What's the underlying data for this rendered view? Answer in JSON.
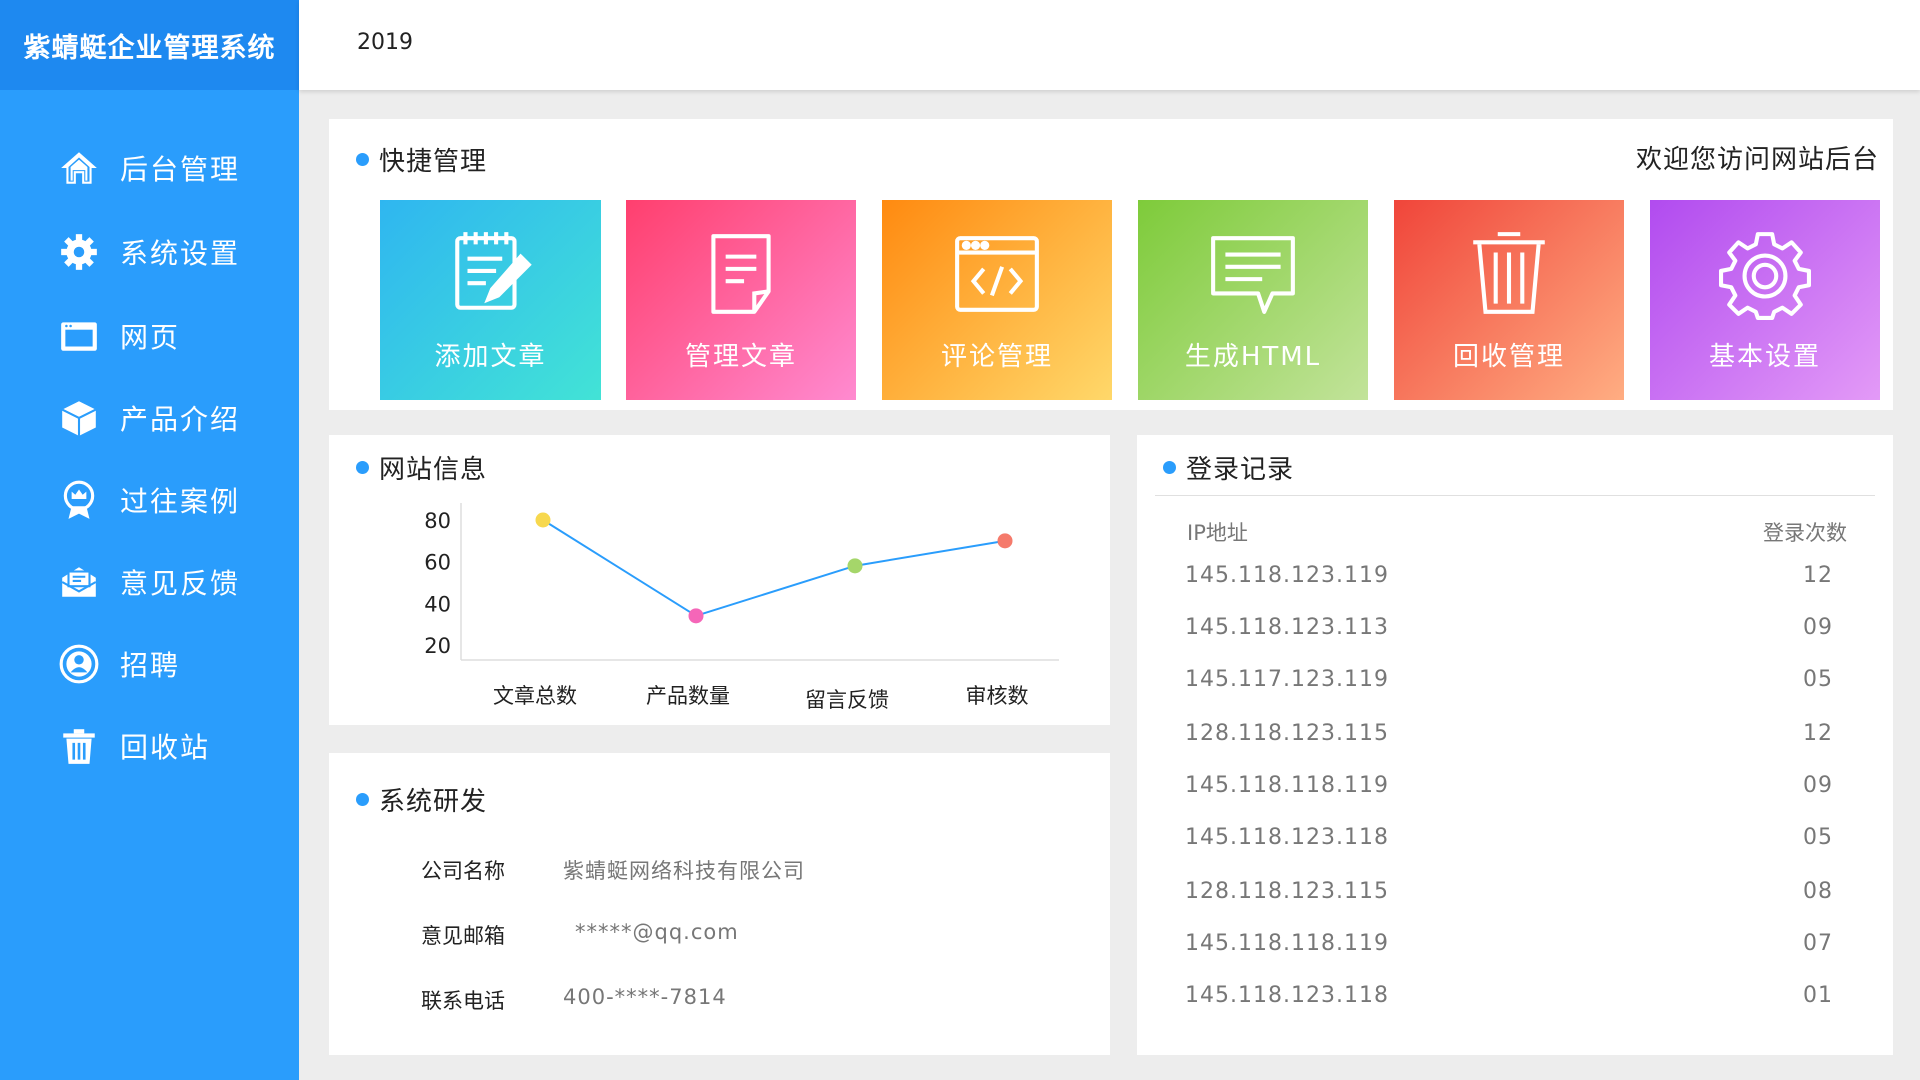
{
  "app": {
    "title": "紫蜻蜓企业管理系统",
    "year": "2019"
  },
  "sidebar": {
    "items": [
      {
        "label": "后台管理",
        "icon": "home-icon"
      },
      {
        "label": "系统设置",
        "icon": "gear-icon"
      },
      {
        "label": "网页",
        "icon": "browser-window-icon"
      },
      {
        "label": "产品介绍",
        "icon": "cube-icon"
      },
      {
        "label": "过往案例",
        "icon": "badge-icon"
      },
      {
        "label": "意见反馈",
        "icon": "feedback-icon"
      },
      {
        "label": "招聘",
        "icon": "user-circle-icon"
      },
      {
        "label": "回收站",
        "icon": "trash-icon"
      }
    ]
  },
  "quick": {
    "title": "快捷管理",
    "welcome": "欢迎您访问网站后台",
    "tiles": [
      {
        "label": "添加文章",
        "icon": "edit-document-icon",
        "colors": [
          "#2fb6f0",
          "#42e3d6"
        ]
      },
      {
        "label": "管理文章",
        "icon": "document-icon",
        "colors": [
          "#ff3f6e",
          "#ff8ad0"
        ]
      },
      {
        "label": "评论管理",
        "icon": "code-window-icon",
        "colors": [
          "#ff8a10",
          "#ffd86a"
        ]
      },
      {
        "label": "生成HTML",
        "icon": "message-icon",
        "colors": [
          "#7ecb3a",
          "#c2e39a"
        ]
      },
      {
        "label": "回收管理",
        "icon": "trash-icon",
        "colors": [
          "#f0453a",
          "#ffad82"
        ]
      },
      {
        "label": "基本设置",
        "icon": "gear-icon",
        "colors": [
          "#b14bef",
          "#e39af7"
        ]
      }
    ]
  },
  "site_info": {
    "title": "网站信息"
  },
  "chart_data": {
    "type": "line",
    "categories": [
      "文章总数",
      "产品数量",
      "留言反馈",
      "审核数"
    ],
    "values": [
      80,
      34,
      58,
      70
    ],
    "point_colors": [
      "#f7d84e",
      "#f566b8",
      "#a5d66a",
      "#f57a6b"
    ],
    "line_color": "#2a9dfc",
    "yticks": [
      80,
      60,
      40,
      20
    ],
    "ylim": [
      20,
      80
    ],
    "title": "",
    "xlabel": "",
    "ylabel": ""
  },
  "dev": {
    "title": "系统研发",
    "rows": [
      {
        "key": "公司名称",
        "value": "紫蜻蜓网络科技有限公司"
      },
      {
        "key": "意见邮箱",
        "value": "*****@qq.com"
      },
      {
        "key": "联系电话",
        "value": "400-****-7814"
      }
    ]
  },
  "login": {
    "title": "登录记录",
    "col_ip": "IP地址",
    "col_count": "登录次数",
    "rows": [
      {
        "ip": "145.118.123.119",
        "count": "12"
      },
      {
        "ip": "145.118.123.113",
        "count": "09"
      },
      {
        "ip": "145.117.123.119",
        "count": "05"
      },
      {
        "ip": "128.118.123.115",
        "count": "12"
      },
      {
        "ip": "145.118.118.119",
        "count": "09"
      },
      {
        "ip": "145.118.123.118",
        "count": "05"
      },
      {
        "ip": "128.118.123.115",
        "count": "08"
      },
      {
        "ip": "145.118.118.119",
        "count": "07"
      },
      {
        "ip": "145.118.123.118",
        "count": "01"
      }
    ]
  }
}
